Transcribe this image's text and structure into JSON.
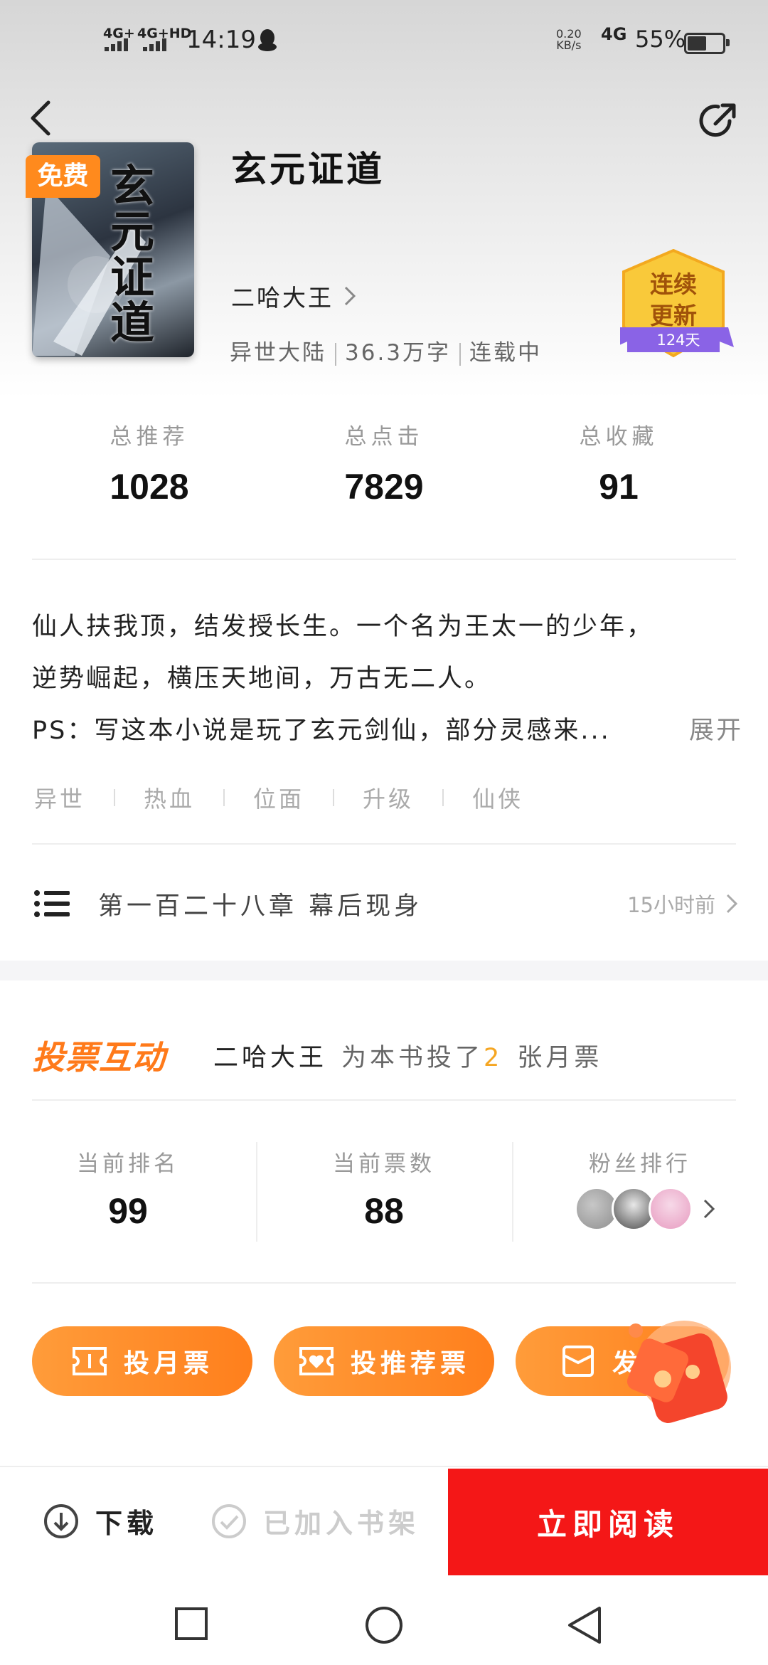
{
  "status_bar": {
    "net1": "4G+",
    "net2": "4G+HD",
    "time": "14:19",
    "speed_top": "0.20",
    "speed_bottom": "KB/s",
    "net3": "4G",
    "battery": "55%",
    "battery_level": 0.55
  },
  "book": {
    "title": "玄元证道",
    "free_badge": "免费",
    "cover_title": "玄元证道",
    "author": "二哈大王",
    "category": "异世大陆",
    "word_count": "36.3万字",
    "status": "连载中",
    "badge_line1": "连续",
    "badge_line2": "更新",
    "badge_days": "124天"
  },
  "stats": [
    {
      "label": "总推荐",
      "value": "1028"
    },
    {
      "label": "总点击",
      "value": "7829"
    },
    {
      "label": "总收藏",
      "value": "91"
    }
  ],
  "description": {
    "line1": "仙人扶我顶，结发授长生。一个名为王太一的少年，",
    "line2": "逆势崛起，横压天地间，万古无二人。",
    "line3": "PS：写这本小说是玩了玄元剑仙，部分灵感来...",
    "expand": "展开"
  },
  "tags": [
    "异世",
    "热血",
    "位面",
    "升级",
    "仙侠"
  ],
  "latest_chapter": {
    "name": "第一百二十八章 幕后现身",
    "time": "15小时前"
  },
  "vote": {
    "title": "投票互动",
    "user": "二哈大王",
    "msg_pre": "为本书投了",
    "count": "2",
    "msg_post": "张月票",
    "stats": [
      {
        "label": "当前排名",
        "value": "99"
      },
      {
        "label": "当前票数",
        "value": "88"
      },
      {
        "label": "粉丝排行",
        "value": ""
      }
    ],
    "buttons": [
      "投月票",
      "投推荐票",
      "发"
    ]
  },
  "bottom": {
    "download": "下载",
    "shelf": "已加入书架",
    "read": "立即阅读"
  },
  "colors": {
    "accent_orange": "#ff7f1c",
    "read_red": "#f41717",
    "vote_count": "#f5a623"
  }
}
